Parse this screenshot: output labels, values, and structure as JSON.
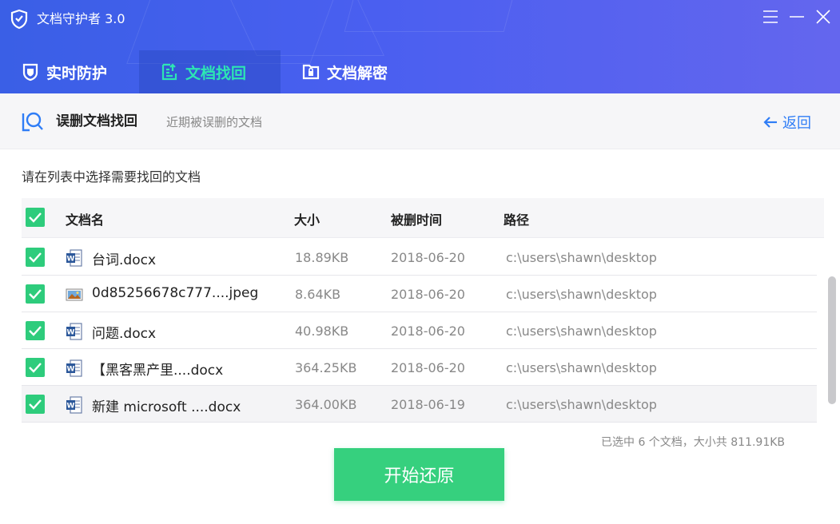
{
  "app": {
    "title": "文档守护者 3.0",
    "accent_color": "#4a5ff0",
    "active_tab_color": "#2de6b3",
    "check_color": "#2ecc7c",
    "button_color": "#36d07e"
  },
  "tabs": [
    {
      "label": "实时防护",
      "icon": "shield-icon",
      "active": false
    },
    {
      "label": "文档找回",
      "icon": "document-recover-icon",
      "active": true
    },
    {
      "label": "文档解密",
      "icon": "folder-lock-icon",
      "active": false
    }
  ],
  "subheader": {
    "title": "误删文档找回",
    "description": "近期被误删的文档",
    "back_label": "返回"
  },
  "instruction": "请在列表中选择需要找回的文档",
  "table": {
    "headers": {
      "name": "文档名",
      "size": "大小",
      "deleted_time": "被删时间",
      "path": "路径"
    },
    "select_all": true,
    "rows": [
      {
        "checked": true,
        "icon": "word-doc-icon",
        "name": "台词.docx",
        "size": "18.89KB",
        "date": "2018-06-20",
        "path": "c:\\users\\shawn\\desktop"
      },
      {
        "checked": true,
        "icon": "image-file-icon",
        "name": "0d85256678c777....jpeg",
        "size": "8.64KB",
        "date": "2018-06-20",
        "path": "c:\\users\\shawn\\desktop"
      },
      {
        "checked": true,
        "icon": "word-doc-icon",
        "name": "问题.docx",
        "size": "40.98KB",
        "date": "2018-06-20",
        "path": "c:\\users\\shawn\\desktop"
      },
      {
        "checked": true,
        "icon": "word-doc-icon",
        "name": "【黑客黑产里....docx",
        "size": "364.25KB",
        "date": "2018-06-20",
        "path": "c:\\users\\shawn\\desktop"
      },
      {
        "checked": true,
        "icon": "word-doc-icon",
        "name": "新建 microsoft ....docx",
        "size": "364.00KB",
        "date": "2018-06-19",
        "path": "c:\\users\\shawn\\desktop"
      }
    ]
  },
  "summary": "已选中 6 个文档，大小共 811.91KB",
  "restore_button": "开始还原"
}
